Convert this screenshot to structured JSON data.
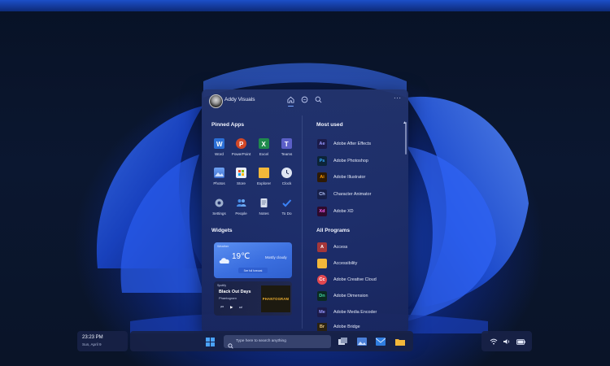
{
  "user": {
    "name": "Addy Visuals"
  },
  "header": {
    "more_label": "···"
  },
  "pinned": {
    "title": "Pinned Apps",
    "apps": [
      {
        "label": "Word",
        "icon": "word-icon",
        "color": "#2b6fd6"
      },
      {
        "label": "PowerPoint",
        "icon": "powerpoint-icon",
        "color": "#d24726"
      },
      {
        "label": "Excel",
        "icon": "excel-icon",
        "color": "#1f8a4c"
      },
      {
        "label": "Teams",
        "icon": "teams-icon",
        "color": "#5b5fc7"
      },
      {
        "label": "Photos",
        "icon": "photos-icon",
        "color": "#4a7fd8"
      },
      {
        "label": "Store",
        "icon": "store-icon",
        "color": "#e9eef8"
      },
      {
        "label": "Explorer",
        "icon": "folder-icon",
        "color": "#f3b83a"
      },
      {
        "label": "Clock",
        "icon": "clock-icon",
        "color": "#dfe6f3"
      },
      {
        "label": "Settings",
        "icon": "gear-icon",
        "color": "#9fb1cf"
      },
      {
        "label": "People",
        "icon": "people-icon",
        "color": "#4a8fe8"
      },
      {
        "label": "Notes",
        "icon": "notes-icon",
        "color": "#d9e0ee"
      },
      {
        "label": "To Do",
        "icon": "checkmark-icon",
        "color": "#3b82f6"
      }
    ]
  },
  "widgets": {
    "title": "Widgets",
    "weather": {
      "header": "Weather",
      "temp": "19℃",
      "condition": "Mostly cloudy",
      "button": "See full forecast"
    },
    "music": {
      "app": "Spotify",
      "song": "Black Out Days",
      "artist": "Phantogram",
      "album_art_text": "PHANTOGRAM"
    }
  },
  "most_used": {
    "title": "Most used",
    "items": [
      {
        "label": "Adobe After Effects",
        "abbr": "Ae",
        "fg": "#9999ff",
        "bg": "#1b1b4a"
      },
      {
        "label": "Adobe Photoshop",
        "abbr": "Ps",
        "fg": "#31a8ff",
        "bg": "#0c2438"
      },
      {
        "label": "Adobe Illustrator",
        "abbr": "Ai",
        "fg": "#ff9a00",
        "bg": "#2e1a05"
      },
      {
        "label": "Character Animator",
        "abbr": "Ch",
        "fg": "#b8c8ff",
        "bg": "#17204a"
      },
      {
        "label": "Adobe XD",
        "abbr": "Xd",
        "fg": "#ff61f6",
        "bg": "#2d0a2c"
      }
    ]
  },
  "all_programs": {
    "title": "All Programs",
    "items": [
      {
        "label": "Access",
        "icon": "access-icon",
        "abbr": "A",
        "fg": "#ffffff",
        "bg": "#a4373a"
      },
      {
        "label": "Accessibility",
        "icon": "folder-icon",
        "abbr": "",
        "fg": "#f3b83a",
        "bg": "#f3b83a"
      },
      {
        "label": "Adobe Creative Cloud",
        "icon": "creative-cloud-icon",
        "abbr": "Cc",
        "fg": "#ffffff",
        "bg": "#e34850"
      },
      {
        "label": "Adobe Dimension",
        "icon": "dimension-icon",
        "abbr": "Dn",
        "fg": "#3fd6a0",
        "bg": "#0b2a22"
      },
      {
        "label": "Adobe Media Encoder",
        "icon": "media-encoder-icon",
        "abbr": "Me",
        "fg": "#9999ff",
        "bg": "#1b1b4a"
      },
      {
        "label": "Adobe Bridge",
        "icon": "bridge-icon",
        "abbr": "Br",
        "fg": "#e0c080",
        "bg": "#2b2210"
      }
    ]
  },
  "clock": {
    "time": "23:23 PM",
    "date": "Sun, April 9"
  },
  "taskbar": {
    "search_placeholder": "Type here to search anything"
  },
  "colors": {
    "accent": "#3b6fe0",
    "menu_bg": "#22346e"
  }
}
